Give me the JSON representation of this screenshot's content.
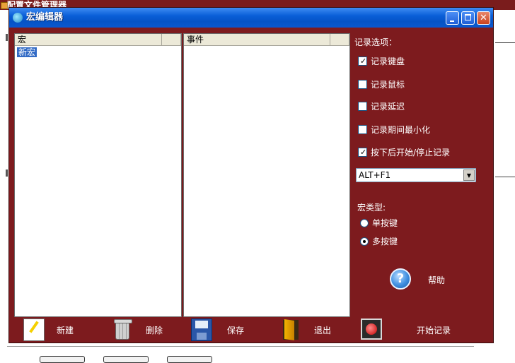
{
  "background": {
    "title": "配置文件管理器"
  },
  "dialog": {
    "title": "宏编辑器",
    "window_buttons": [
      "minimize-icon",
      "maximize-icon",
      "close-icon"
    ]
  },
  "macro_list": {
    "column": "宏",
    "items": [
      "新宏"
    ],
    "selected": "新宏"
  },
  "event_list": {
    "column": "事件"
  },
  "record_options": {
    "title": "记录选项：",
    "checkboxes": [
      {
        "label": "记录键盘",
        "checked": true
      },
      {
        "label": "记录鼠标",
        "checked": false
      },
      {
        "label": "记录延迟",
        "checked": false
      },
      {
        "label": "记录期间最小化",
        "checked": false
      },
      {
        "label": "按下后开始/停止记录",
        "checked": true
      }
    ],
    "hotkey": "ALT+F1"
  },
  "macro_type": {
    "title": "宏类型:",
    "options": [
      {
        "label": "单按键",
        "selected": false
      },
      {
        "label": "多按键",
        "selected": true
      }
    ]
  },
  "help": {
    "icon": "help-icon",
    "label": "帮助"
  },
  "toolbar": {
    "new_label": "新建",
    "delete_label": "删除",
    "save_label": "保存",
    "exit_label": "退出",
    "record_label": "开始记录"
  },
  "colors": {
    "dialog_bg": "#7d1b1e",
    "titlebar": "#0a5fd8",
    "selection": "#316ac5"
  }
}
